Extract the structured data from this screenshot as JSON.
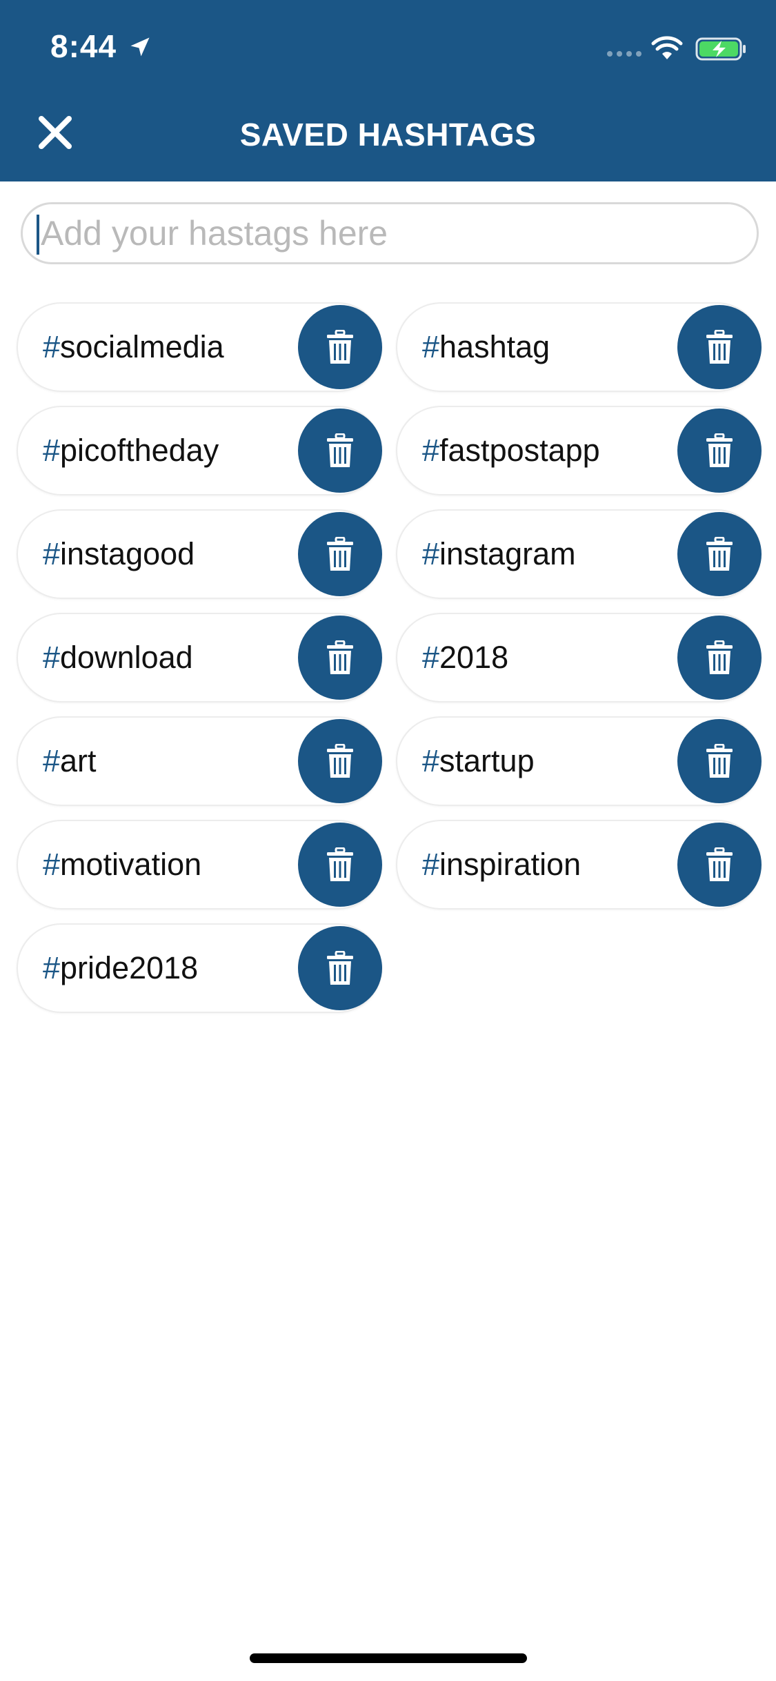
{
  "status_bar": {
    "time": "8:44",
    "icons": [
      "location-arrow-icon",
      "signal-dots-icon",
      "wifi-icon",
      "battery-charging-icon"
    ]
  },
  "header": {
    "title": "SAVED HASHTAGS",
    "close_icon": "close-icon",
    "background": "#1b5686"
  },
  "search": {
    "placeholder": "Add your hastags here",
    "value": ""
  },
  "hashtags": [
    {
      "hash": "#",
      "text": "socialmedia"
    },
    {
      "hash": "#",
      "text": "hashtag"
    },
    {
      "hash": "#",
      "text": "picoftheday"
    },
    {
      "hash": "#",
      "text": "fastpostapp"
    },
    {
      "hash": "#",
      "text": "instagood"
    },
    {
      "hash": "#",
      "text": "instagram"
    },
    {
      "hash": "#",
      "text": "download"
    },
    {
      "hash": "#",
      "text": "2018"
    },
    {
      "hash": "#",
      "text": "art"
    },
    {
      "hash": "#",
      "text": "startup"
    },
    {
      "hash": "#",
      "text": "motivation"
    },
    {
      "hash": "#",
      "text": "inspiration"
    },
    {
      "hash": "#",
      "text": "pride2018"
    }
  ],
  "delete_icon": "trash-icon",
  "colors": {
    "accent": "#1b5686",
    "chip_border": "#ececec",
    "placeholder": "#b9b9b9"
  }
}
